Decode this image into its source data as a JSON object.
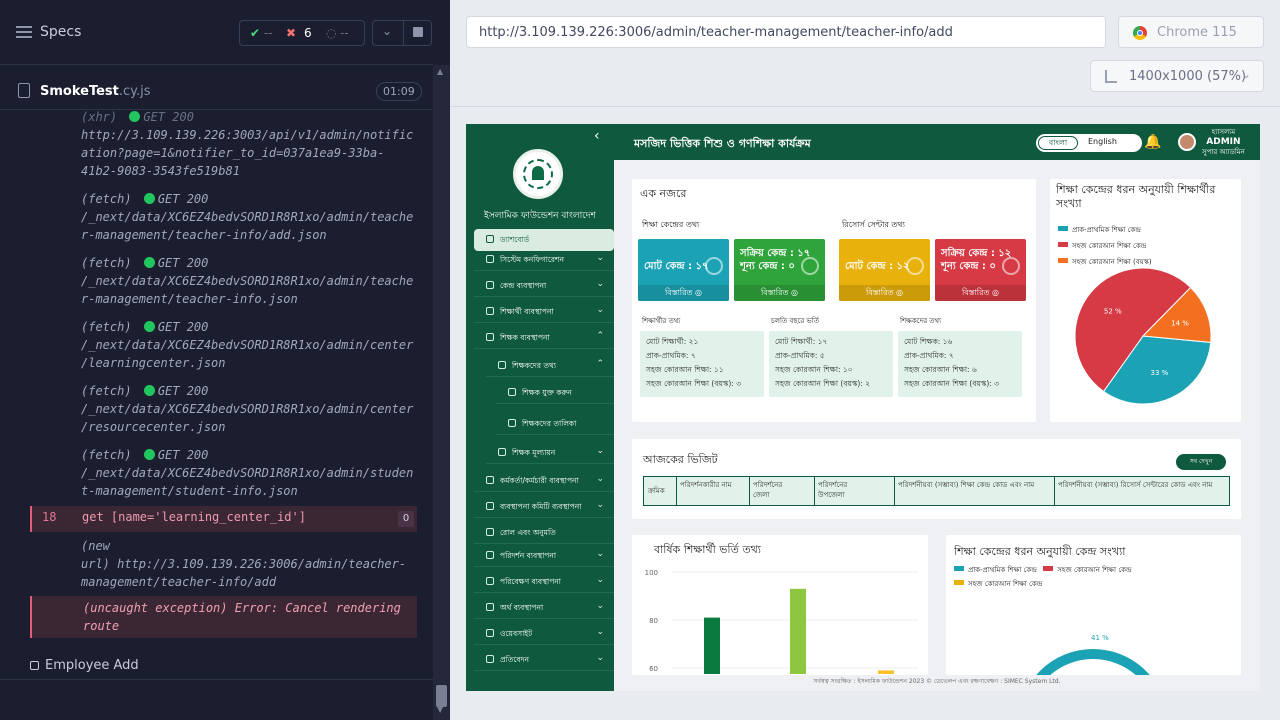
{
  "runner": {
    "specs_label": "Specs",
    "stats": {
      "passed": "--",
      "failed": "6",
      "pending": "--"
    },
    "spec_name": "SmokeTest",
    "spec_ext": ".cy.js",
    "duration": "01:09",
    "logs": [
      {
        "lines": [
          "http://3.109.139.226:3003/api/v1/admin/notific",
          "ation?page=1&notifier_to_id=037a1ea9-33ba-",
          "41b2-9083-3543fe519b81"
        ]
      },
      {
        "prefix": "(fetch)",
        "status": "GET 200",
        "lines": [
          "/_next/data/XC6EZ4bedvSORD1R8R1xo/admin/teache",
          "r-management/teacher-info/add.json"
        ]
      },
      {
        "prefix": "(fetch)",
        "status": "GET 200",
        "lines": [
          "/_next/data/XC6EZ4bedvSORD1R8R1xo/admin/teache",
          "r-management/teacher-info.json"
        ]
      },
      {
        "prefix": "(fetch)",
        "status": "GET 200",
        "lines": [
          "/_next/data/XC6EZ4bedvSORD1R8R1xo/admin/center",
          "/learningcenter.json"
        ]
      },
      {
        "prefix": "(fetch)",
        "status": "GET 200",
        "lines": [
          "/_next/data/XC6EZ4bedvSORD1R8R1xo/admin/center",
          "/resourcecenter.json"
        ]
      },
      {
        "prefix": "(fetch)",
        "status": "GET 200",
        "lines": [
          "/_next/data/XC6EZ4bedvSORD1R8R1xo/admin/studen",
          "t-management/student-info.json"
        ]
      }
    ],
    "failed_cmd": {
      "num": "18",
      "text": "get  [name='learning_center_id']",
      "count": "0"
    },
    "new_url": [
      "(new",
      "url)  http://3.109.139.226:3006/admin/teacher-",
      "management/teacher-info/add"
    ],
    "error": [
      "(uncaught exception)  Error: Cancel rendering",
      "route"
    ],
    "test_title": "Employee Add"
  },
  "browser": {
    "url": "http://3.109.139.226:3006/admin/teacher-management/teacher-info/add",
    "name": "Chrome 115",
    "viewport": "1400x1000  (57%)"
  },
  "app": {
    "org_name": "ইসলামিক ফাউন্ডেশন বাংলাদেশ",
    "title": "মসজিদ ভিত্তিক শিশু ও গণশিক্ষা কার্যক্রম",
    "lang_bn": "বাংলা",
    "lang_en": "English",
    "user_role": "হ্যাসল্যম",
    "user_name": "ADMIN",
    "user_sub": "সুপার অ্যাডমিন",
    "nav": [
      {
        "label": "ড্যাশবোর্ড",
        "active": true
      },
      {
        "label": "সিস্টেম কনফিগারেশন"
      },
      {
        "label": "কেন্দ্র ব্যবস্থাপনা"
      },
      {
        "label": "শিক্ষার্থী ব্যবস্থাপনা"
      },
      {
        "label": "শিক্ষক ব্যবস্থাপনা"
      },
      {
        "label": "শিক্ষকদের তথ্য"
      },
      {
        "label": "শিক্ষক যুক্ত করুন"
      },
      {
        "label": "শিক্ষকদের তালিকা"
      },
      {
        "label": "শিক্ষক মূল্যায়ন"
      },
      {
        "label": "কর্মকর্তা/কর্মচারী ব্যবস্থাপনা"
      },
      {
        "label": "ব্যবস্থাপনা কমিটি ব্যবস্থাপনা"
      },
      {
        "label": "রোল এবং অনুমতি"
      },
      {
        "label": "পরিদর্শন ব্যবস্থাপনা"
      },
      {
        "label": "পরিবেক্ষণ ব্যবস্থাপনা"
      },
      {
        "label": "অর্থ ব্যবস্থাপনা"
      },
      {
        "label": "ওয়েবসাইট"
      },
      {
        "label": "প্রতিবেদন"
      }
    ],
    "overview": {
      "title": "এক নজরে",
      "edu_center_label": "শিক্ষা কেন্দ্রের তথ্য",
      "resource_center_label": "রিসোর্স সেন্টার তথ্য",
      "stats": [
        {
          "value": "মোট কেন্দ্র : ১৭",
          "details": "বিস্তারিত",
          "color": "#1ba3b5"
        },
        {
          "value": "সক্রিয় কেন্দ্র : ১৭ শূন্য কেন্দ্র : ০",
          "details": "বিস্তারিত",
          "color": "#2ea43a"
        },
        {
          "value": "মোট কেন্দ্র : ১২",
          "details": "বিস্তারিত",
          "color": "#e8b10c"
        },
        {
          "value": "সক্রিয় কেন্দ্র : ১২ শূন্য কেন্দ্র : ০",
          "details": "বিস্তারিত",
          "color": "#d63a44"
        }
      ],
      "student_info": {
        "title": "শিক্ষার্থীর তথ্য",
        "lines": [
          "মোট শিক্ষার্থী: ২১",
          "প্রাক-প্রাথমিক: ৭",
          "সহজ কোরআন শিক্ষা: ১১",
          "সহজ কোরআন শিক্ষা (বয়স্ক): ৩"
        ]
      },
      "year_info": {
        "title": "চলতি বছরে ভর্তি",
        "lines": [
          "মোট শিক্ষার্থী: ১৭",
          "প্রাক-প্রাথমিক: ৫",
          "সহজ কোরআন শিক্ষা: ১০",
          "সহজ কোরআন শিক্ষা (বয়স্ক): ২"
        ]
      },
      "teacher_info": {
        "title": "শিক্ষকদের তথ্য",
        "lines": [
          "মোট শিক্ষক: ১৬",
          "প্রাক-প্রাথমিক: ৭",
          "সহজ কোরআন শিক্ষা: ৬",
          "সহজ কোরআন শিক্ষা (বয়স্ক): ৩"
        ]
      }
    },
    "pie": {
      "title": "শিক্ষা কেন্দ্রের ধরন অনুযায়ী শিক্ষার্থীর সংখ্যা",
      "legend": [
        {
          "label": "প্রাক-প্রাথমিক শিক্ষা কেন্দ্র",
          "color": "#1ba3b5"
        },
        {
          "label": "সহজ কোরআন শিক্ষা কেন্দ্র",
          "color": "#d63a44"
        },
        {
          "label": "সহজ কোরআন শিক্ষা (বয়স্ক)",
          "color": "#f37021"
        }
      ]
    },
    "visit": {
      "title": "আজকের ভিজিট",
      "show_all": "সব দেখুন",
      "columns": [
        "ক্রমিক",
        "পরিদর্শনকারীর নাম",
        "পরিদর্শনের জেলা",
        "পরিদর্শনের উপজেলা",
        "পরিদর্শনীয়ব্য (সম্ভাব্য) শিক্ষা কেন্দ্র কোড এবং নাম",
        "পরিদর্শনীয়ব্য (সম্ভাব্য) রিসোর্স সেন্টারের কোড এবং নাম"
      ]
    },
    "bar_title": "বার্ষিক শিক্ষার্থী ভর্তি তথ্য",
    "donut_title": "শিক্ষা কেন্দ্রের ধরন অনুযায়ী কেন্দ্র সংখ্যা",
    "donut_legend": [
      {
        "label": "প্রাক-প্রাথমিক শিক্ষা কেন্দ্র",
        "color": "#1ba3b5"
      },
      {
        "label": "সহজ কোরআন শিক্ষা কেন্দ্র",
        "color": "#d63a44"
      },
      {
        "label": "সহজ কোরআন শিক্ষা কেন্দ্র",
        "color": "#e8b10c"
      }
    ],
    "footer": "সর্বস্বত্ব সংরক্ষিত : ইসলামিক ফাউন্ডেশন 2023 © ডেভেলপ এবং রক্ষণাবেক্ষণ : SIMEC System Ltd."
  },
  "chart_data": [
    {
      "type": "pie",
      "title": "শিক্ষা কেন্দ্রের ধরন অনুযায়ী শিক্ষার্থীর সংখ্যা",
      "categories": [
        "প্রাক-প্রাথমিক শিক্ষা কেন্দ্র",
        "সহজ কোরআন শিক্ষা কেন্দ্র",
        "সহজ কোরআন শিক্ষা (বয়স্ক)"
      ],
      "values": [
        33,
        52,
        14
      ],
      "labels": [
        "33 %",
        "52 %",
        "14 %"
      ],
      "colors": [
        "#1ba3b5",
        "#d63a44",
        "#f37021"
      ]
    },
    {
      "type": "bar",
      "title": "বার্ষিক শিক্ষার্থী ভর্তি তথ্য",
      "ylim": [
        50,
        100
      ],
      "yticks": [
        100,
        80,
        60
      ],
      "values": [
        81,
        93,
        59
      ],
      "colors": [
        "#0b7a3e",
        "#8dc63f",
        "#fbc02d"
      ]
    },
    {
      "type": "pie",
      "title": "শিক্ষা কেন্দ্রের ধরন অনুযায়ী কেন্দ্র সংখ্যা",
      "labels": [
        "41 %"
      ]
    }
  ]
}
